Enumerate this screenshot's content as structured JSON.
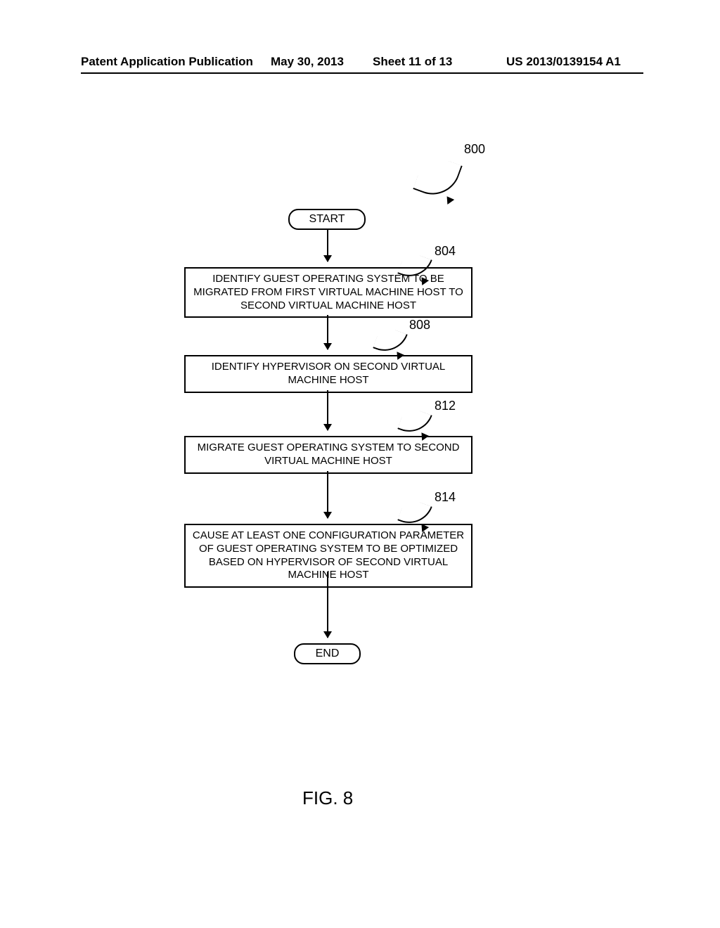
{
  "header": {
    "publication": "Patent Application Publication",
    "date": "May 30, 2013",
    "sheet": "Sheet 11 of 13",
    "number": "US 2013/0139154 A1"
  },
  "figure_label": "FIG. 8",
  "flow": {
    "ref_main": "800",
    "start": "START",
    "end": "END",
    "steps": [
      {
        "ref": "804",
        "text": "IDENTIFY GUEST OPERATING SYSTEM TO BE MIGRATED FROM FIRST VIRTUAL MACHINE HOST TO SECOND VIRTUAL MACHINE HOST"
      },
      {
        "ref": "808",
        "text": "IDENTIFY HYPERVISOR ON SECOND VIRTUAL MACHINE HOST"
      },
      {
        "ref": "812",
        "text": "MIGRATE GUEST OPERATING SYSTEM TO SECOND VIRTUAL MACHINE HOST"
      },
      {
        "ref": "814",
        "text": "CAUSE AT LEAST ONE CONFIGURATION PARAMETER OF GUEST OPERATING SYSTEM TO BE OPTIMIZED BASED ON HYPERVISOR OF SECOND VIRTUAL MACHINE HOST"
      }
    ]
  }
}
